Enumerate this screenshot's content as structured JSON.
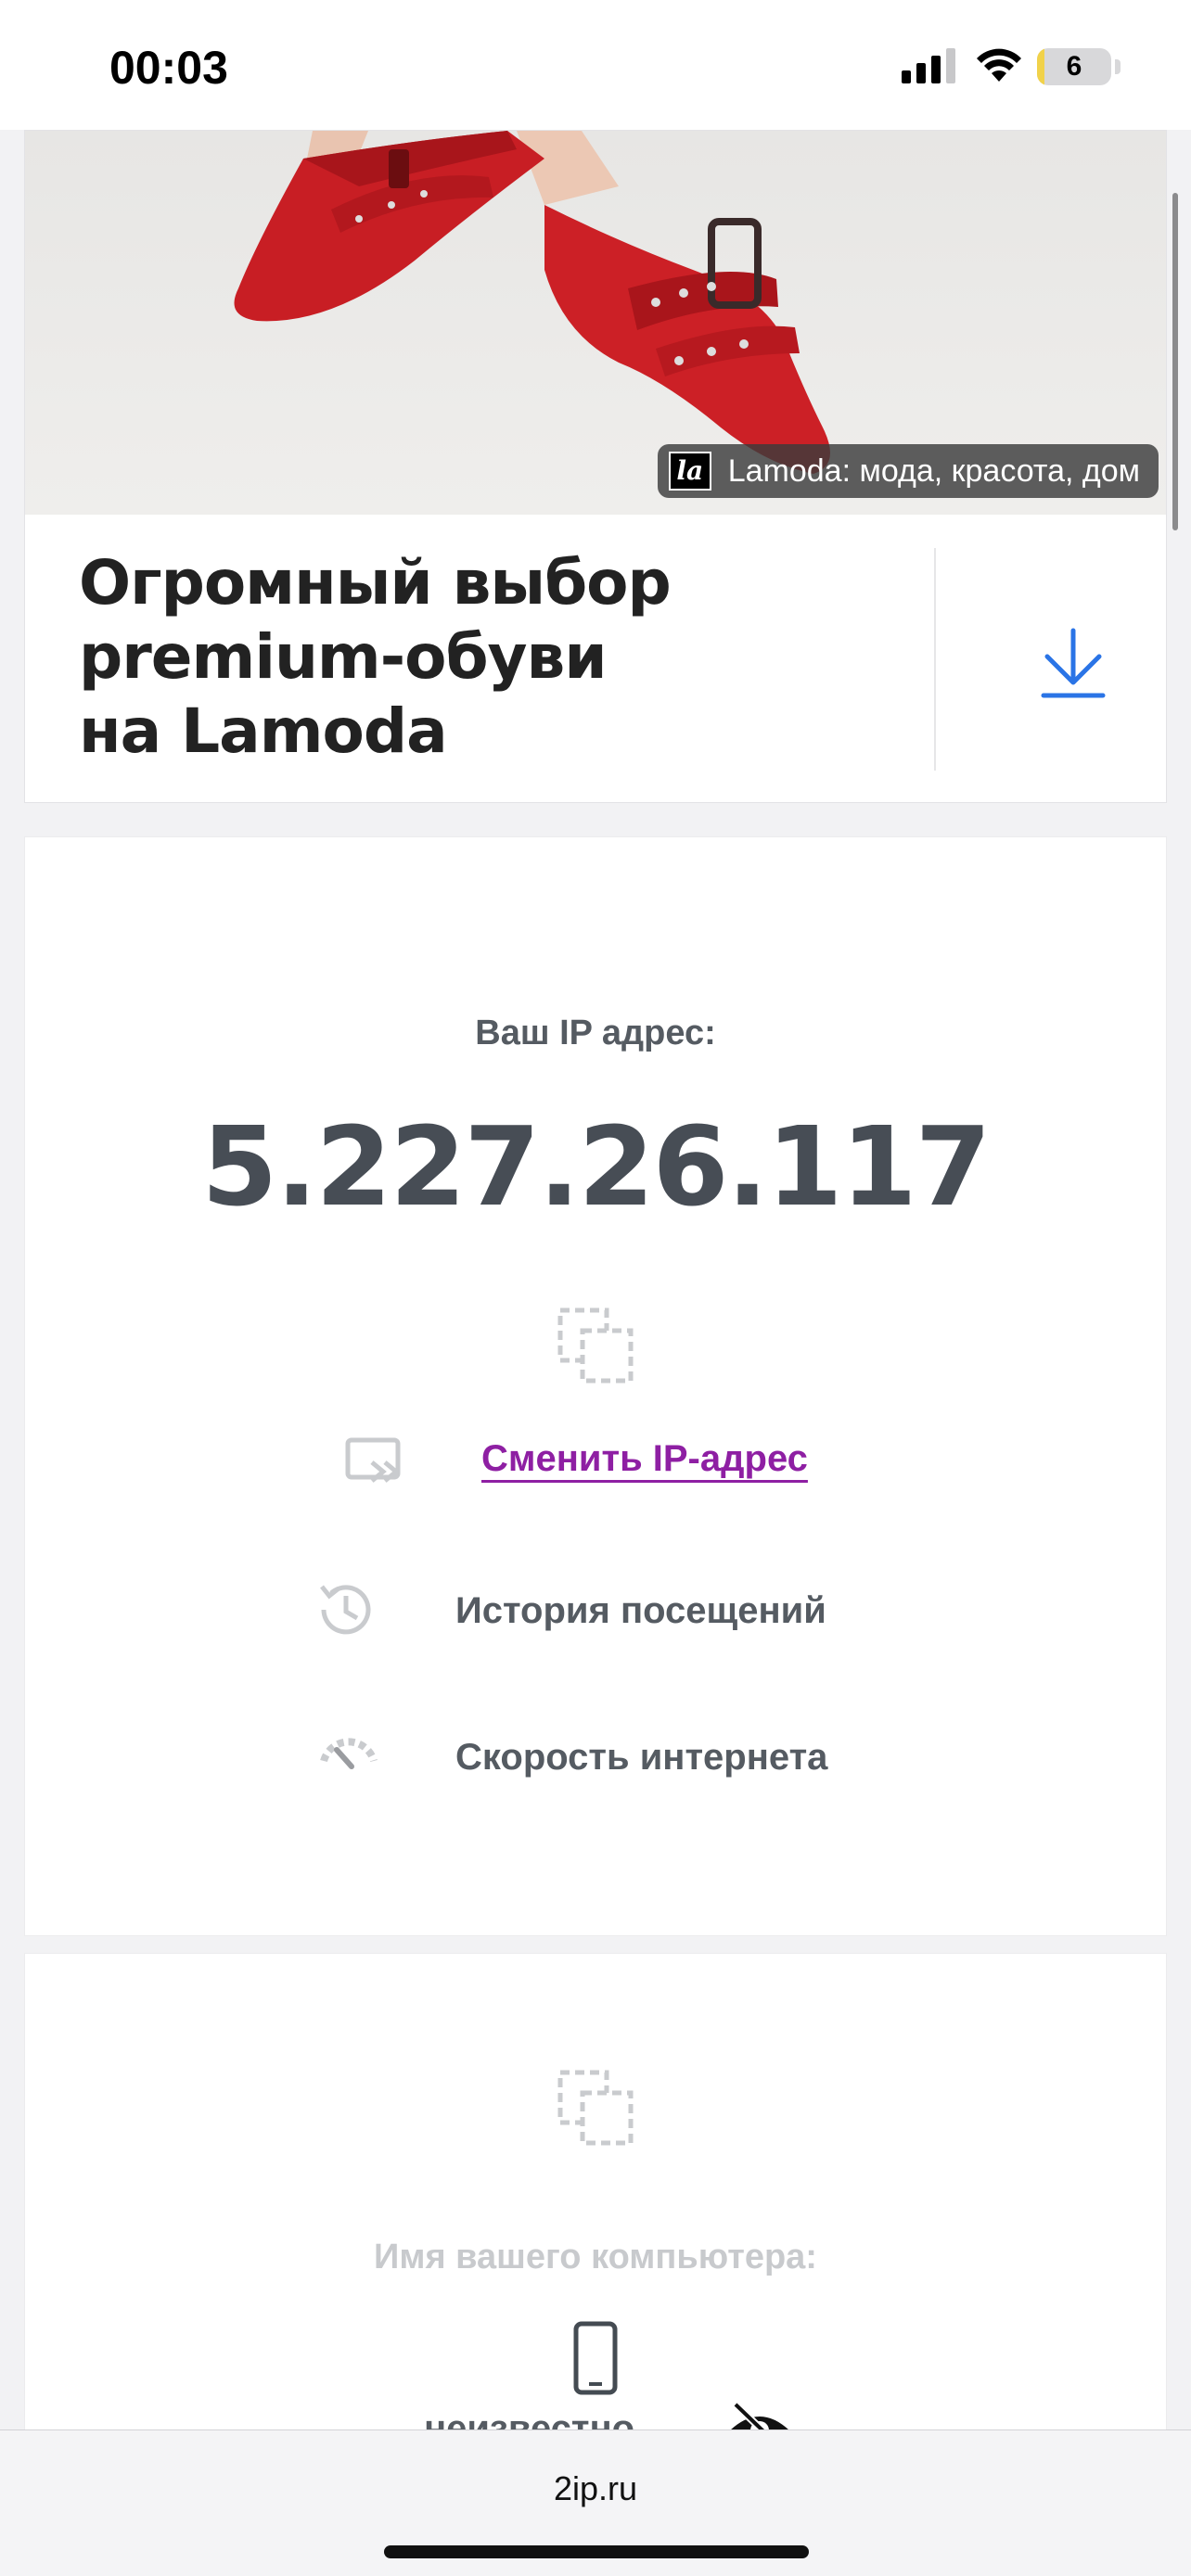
{
  "status_bar": {
    "time": "00:03",
    "battery_level": "6"
  },
  "ad": {
    "source_label": "Lamoda: мода, красота, дом",
    "logo_text": "la",
    "title_lines": [
      "Огромный выбор",
      "premium-обуви",
      "на Lamoda"
    ]
  },
  "ip_section": {
    "label": "Ваш IP адрес:",
    "ip_address": "5.227.26.117",
    "actions": {
      "change_ip": "Сменить IP-адрес",
      "history": "История посещений",
      "speed": "Скорость интернета"
    }
  },
  "computer_section": {
    "label": "Имя вашего компьютера:",
    "value": "неизвестно"
  },
  "browser": {
    "url": "2ip.ru"
  },
  "colors": {
    "link": "#8e1fa3",
    "download_icon": "#2a74e6",
    "ip_text": "#474d55",
    "icon_gray": "#c9cbce"
  }
}
